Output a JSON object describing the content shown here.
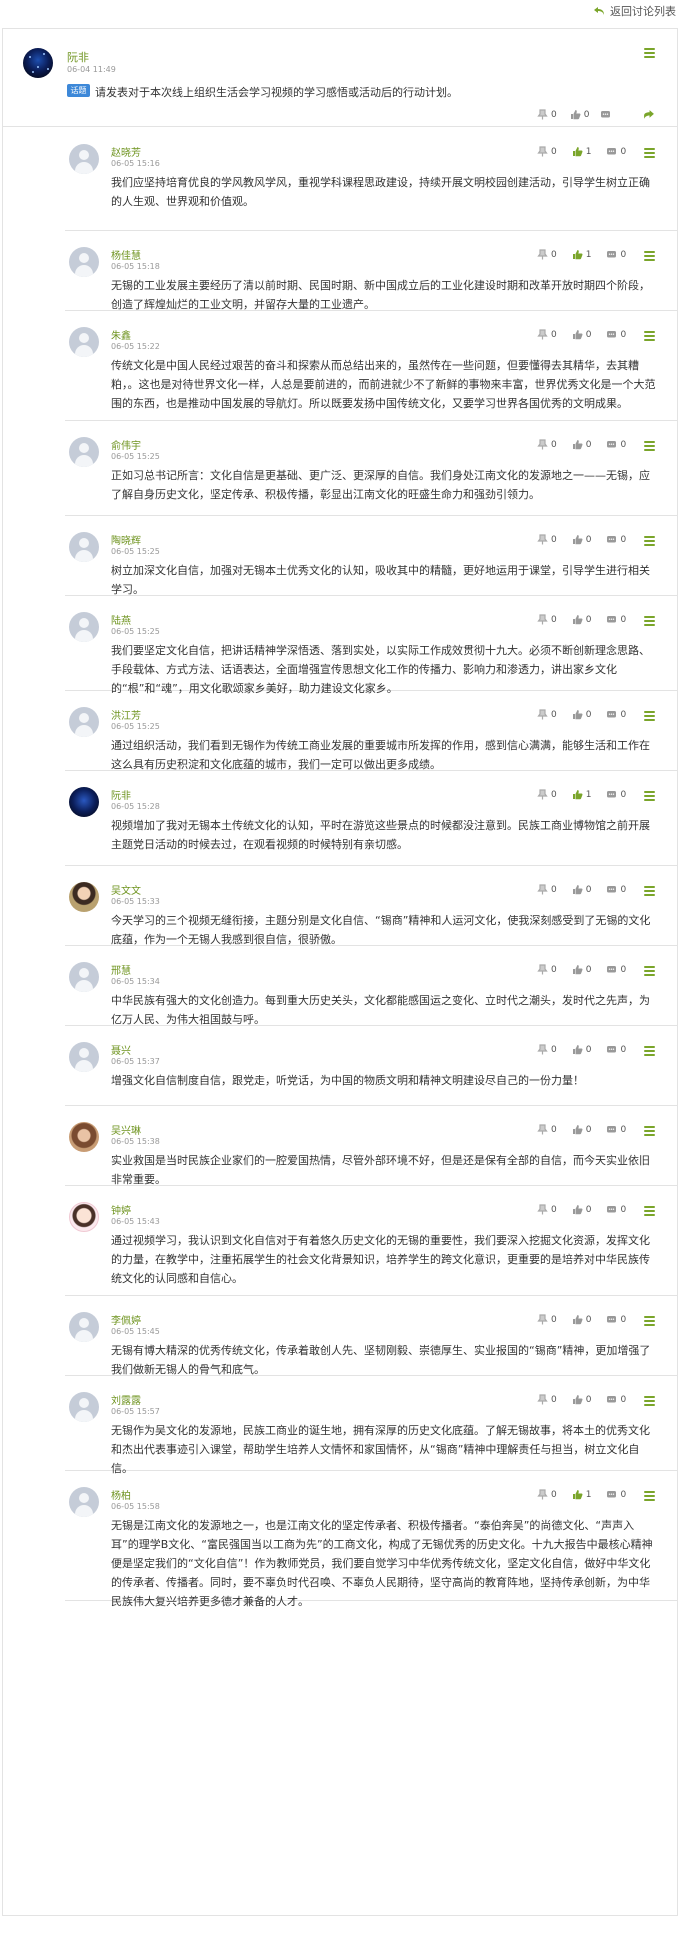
{
  "header": {
    "back_label": "返回讨论列表"
  },
  "main_post": {
    "author": "阮非",
    "time": "06-04 11:49",
    "badge": "话题",
    "title": "请发表对于本次线上组织生活会学习视频的学习感悟或活动后的行动计划。",
    "like_count": "0",
    "comment_count": "0",
    "icons": {
      "like": "thumb-up-icon",
      "comment": "comment-icon",
      "menu": "menu-icon",
      "extra": "pin-icon"
    }
  },
  "colors": {
    "accent_green": "#7aa52a",
    "author_green": "#6f9420",
    "badge_blue": "#3d88d8",
    "border": "#e3e3e3"
  },
  "replies": [
    {
      "author": "赵晓芳",
      "time": "06-05 15:16",
      "avatar": "default",
      "pin": "0",
      "like": "1",
      "comment": "0",
      "text": "我们应坚持培育优良的学风教风学风，重视学科课程思政建设，持续开展文明校园创建活动，引导学生树立正确的人生观、世界观和价值观。"
    },
    {
      "author": "杨佳慧",
      "time": "06-05 15:18",
      "avatar": "default",
      "pin": "0",
      "like": "1",
      "comment": "0",
      "text": "无锡的工业发展主要经历了清以前时期、民国时期、新中国成立后的工业化建设时期和改革开放时期四个阶段，创造了辉煌灿烂的工业文明，并留存大量的工业遗产。"
    },
    {
      "author": "朱鑫",
      "time": "06-05 15:22",
      "avatar": "default",
      "pin": "0",
      "like": "0",
      "comment": "0",
      "text": "传统文化是中国人民经过艰苦的奋斗和探索从而总结出来的，虽然传在一些问题，但要懂得去其精华，去其糟粕，。这也是对待世界文化一样，人总是要前进的，而前进就少不了新鲜的事物来丰富，世界优秀文化是一个大范围的东西，也是推动中国发展的导航灯。所以既要发扬中国传统文化，又要学习世界各国优秀的文明成果。"
    },
    {
      "author": "俞伟宇",
      "time": "06-05 15:25",
      "avatar": "default",
      "pin": "0",
      "like": "0",
      "comment": "0",
      "text": "正如习总书记所言：文化自信是更基础、更广泛、更深厚的自信。我们身处江南文化的发源地之一——无锡，应了解自身历史文化，坚定传承、积极传播，彰显出江南文化的旺盛生命力和强劲引领力。"
    },
    {
      "author": "陶晓辉",
      "time": "06-05 15:25",
      "avatar": "default",
      "pin": "0",
      "like": "0",
      "comment": "0",
      "text": "树立加深文化自信，加强对无锡本土优秀文化的认知，吸收其中的精髓，更好地运用于课堂，引导学生进行相关学习。"
    },
    {
      "author": "陆燕",
      "time": "06-05 15:25",
      "avatar": "default",
      "pin": "0",
      "like": "0",
      "comment": "0",
      "text": "我们要坚定文化自信，把讲话精神学深悟透、落到实处，以实际工作成效贯彻十九大。必须不断创新理念思路、手段载体、方式方法、话语表达，全面增强宣传思想文化工作的传播力、影响力和渗透力，讲出家乡文化的“根”和“魂”，用文化歌颂家乡美好，助力建设文化家乡。"
    },
    {
      "author": "洪江芳",
      "time": "06-05 15:25",
      "avatar": "default",
      "pin": "0",
      "like": "0",
      "comment": "0",
      "text": "通过组织活动，我们看到无锡作为传统工商业发展的重要城市所发挥的作用，感到信心满满，能够生活和工作在这么具有历史积淀和文化底蕴的城市，我们一定可以做出更多成绩。"
    },
    {
      "author": "阮非",
      "time": "06-05 15:28",
      "avatar": "space",
      "pin": "0",
      "like": "1",
      "comment": "0",
      "text": "视频增加了我对无锡本土传统文化的认知，平时在游览这些景点的时候都没注意到。民族工商业博物馆之前开展主题党日活动的时候去过，在观看视频的时候特别有亲切感。"
    },
    {
      "author": "吴文文",
      "time": "06-05 15:33",
      "avatar": "photo-a",
      "pin": "0",
      "like": "0",
      "comment": "0",
      "text": "今天学习的三个视频无缝衔接，主题分别是文化自信、“锡商”精神和人运河文化，使我深刻感受到了无锡的文化底蕴，作为一个无锡人我感到很自信，很骄傲。"
    },
    {
      "author": "邢慧",
      "time": "06-05 15:34",
      "avatar": "default",
      "pin": "0",
      "like": "0",
      "comment": "0",
      "text": "中华民族有强大的文化创造力。每到重大历史关头，文化都能感国运之变化、立时代之潮头，发时代之先声，为亿万人民、为伟大祖国鼓与呼。"
    },
    {
      "author": "聂兴",
      "time": "06-05 15:37",
      "avatar": "default",
      "pin": "0",
      "like": "0",
      "comment": "0",
      "text": "增强文化自信制度自信，跟党走，听党话，为中国的物质文明和精神文明建设尽自己的一份力量！"
    },
    {
      "author": "吴兴琳",
      "time": "06-05 15:38",
      "avatar": "photo-b",
      "pin": "0",
      "like": "0",
      "comment": "0",
      "text": "实业救国是当时民族企业家们的一腔爱国热情，尽管外部环境不好，但是还是保有全部的自信，而今天实业依旧非常重要。"
    },
    {
      "author": "钟婷",
      "time": "06-05 15:43",
      "avatar": "cartoon",
      "pin": "0",
      "like": "0",
      "comment": "0",
      "text": "通过视频学习，我认识到文化自信对于有着悠久历史文化的无锡的重要性，我们要深入挖掘文化资源，发挥文化的力量，在教学中，注重拓展学生的社会文化背景知识，培养学生的跨文化意识，更重要的是培养对中华民族传统文化的认同感和自信心。"
    },
    {
      "author": "李佩婷",
      "time": "06-05 15:45",
      "avatar": "default",
      "pin": "0",
      "like": "0",
      "comment": "0",
      "text": "无锡有博大精深的优秀传统文化，传承着敢创人先、坚韧刚毅、崇德厚生、实业报国的“锡商”精神，更加增强了我们做新无锡人的骨气和底气。"
    },
    {
      "author": "刘露露",
      "time": "06-05 15:57",
      "avatar": "default",
      "pin": "0",
      "like": "0",
      "comment": "0",
      "text": "无锡作为吴文化的发源地，民族工商业的诞生地，拥有深厚的历史文化底蕴。了解无锡故事，将本土的优秀文化和杰出代表事迹引入课堂，帮助学生培养人文情怀和家国情怀，从“锡商”精神中理解责任与担当，树立文化自信。"
    },
    {
      "author": "杨柏",
      "time": "06-05 15:58",
      "avatar": "default",
      "pin": "0",
      "like": "1",
      "comment": "0",
      "text": "无锡是江南文化的发源地之一，也是江南文化的坚定传承者、积极传播者。“泰伯奔吴”的尚德文化、“声声入耳”的理学B文化、“富民强国当以工商为先”的工商文化，构成了无锡优秀的历史文化。十九大报告中最核心精神便是坚定我们的“文化自信”！作为教师党员，我们要自觉学习中华优秀传统文化，坚定文化自信，做好中华文化的传承者、传播者。同时，要不辜负时代召唤、不辜负人民期待，坚守高尚的教育阵地，坚持传承创新，为中华民族伟大复兴培养更多德才兼备的人才。"
    }
  ]
}
